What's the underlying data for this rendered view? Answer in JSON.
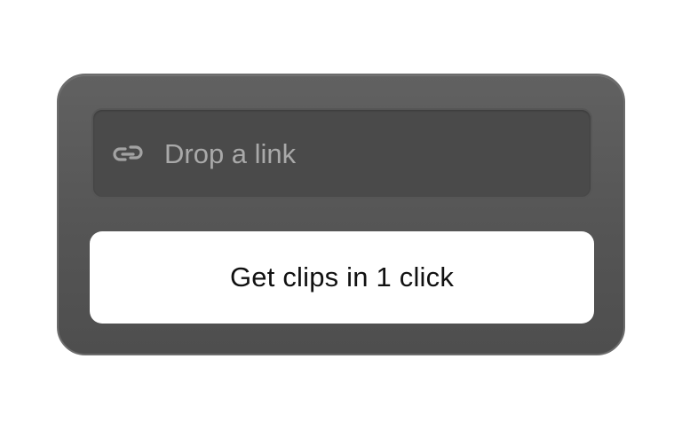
{
  "link_field": {
    "icon": "link-icon",
    "placeholder": "Drop a link",
    "value": ""
  },
  "cta": {
    "label": "Get clips in 1 click"
  },
  "colors": {
    "card_background": "#575757",
    "field_background": "#4a4a4a",
    "placeholder_text": "#a9a9a9",
    "button_background": "#ffffff",
    "button_text": "#111111"
  }
}
